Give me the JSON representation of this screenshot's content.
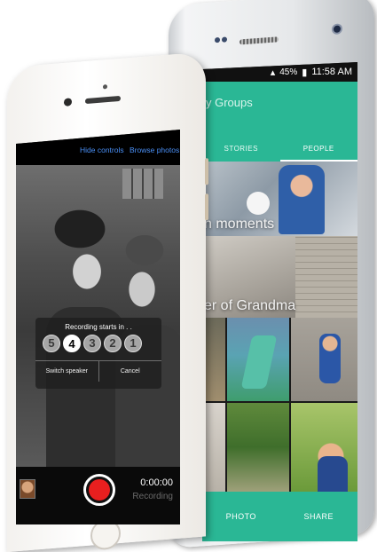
{
  "android": {
    "status": {
      "signal": "45%",
      "time": "11:58 AM"
    },
    "app_title": "y Groups",
    "tabs": [
      {
        "label": "STORIES",
        "active": false
      },
      {
        "label": "PEOPLE",
        "active": true
      }
    ],
    "stories": [
      {
        "label": "n moments"
      },
      {
        "label": "er of Grandma"
      }
    ],
    "bottom_bar": {
      "photo_label": "PHOTO",
      "share_label": "SHARE"
    },
    "accent_color": "#2ab795"
  },
  "iphone": {
    "hide_controls": "Hide controls",
    "browse_photos": "Browse photos",
    "overlay": {
      "caption": "Recording starts in . .",
      "countdown": [
        "5",
        "4",
        "3",
        "2",
        "1"
      ],
      "active_count": "4",
      "switch_speaker": "Switch speaker",
      "cancel": "Cancel"
    },
    "timer": "0:00:00",
    "status": "Recording",
    "record_color": "#e81f1f",
    "link_color": "#4a8ff5"
  }
}
